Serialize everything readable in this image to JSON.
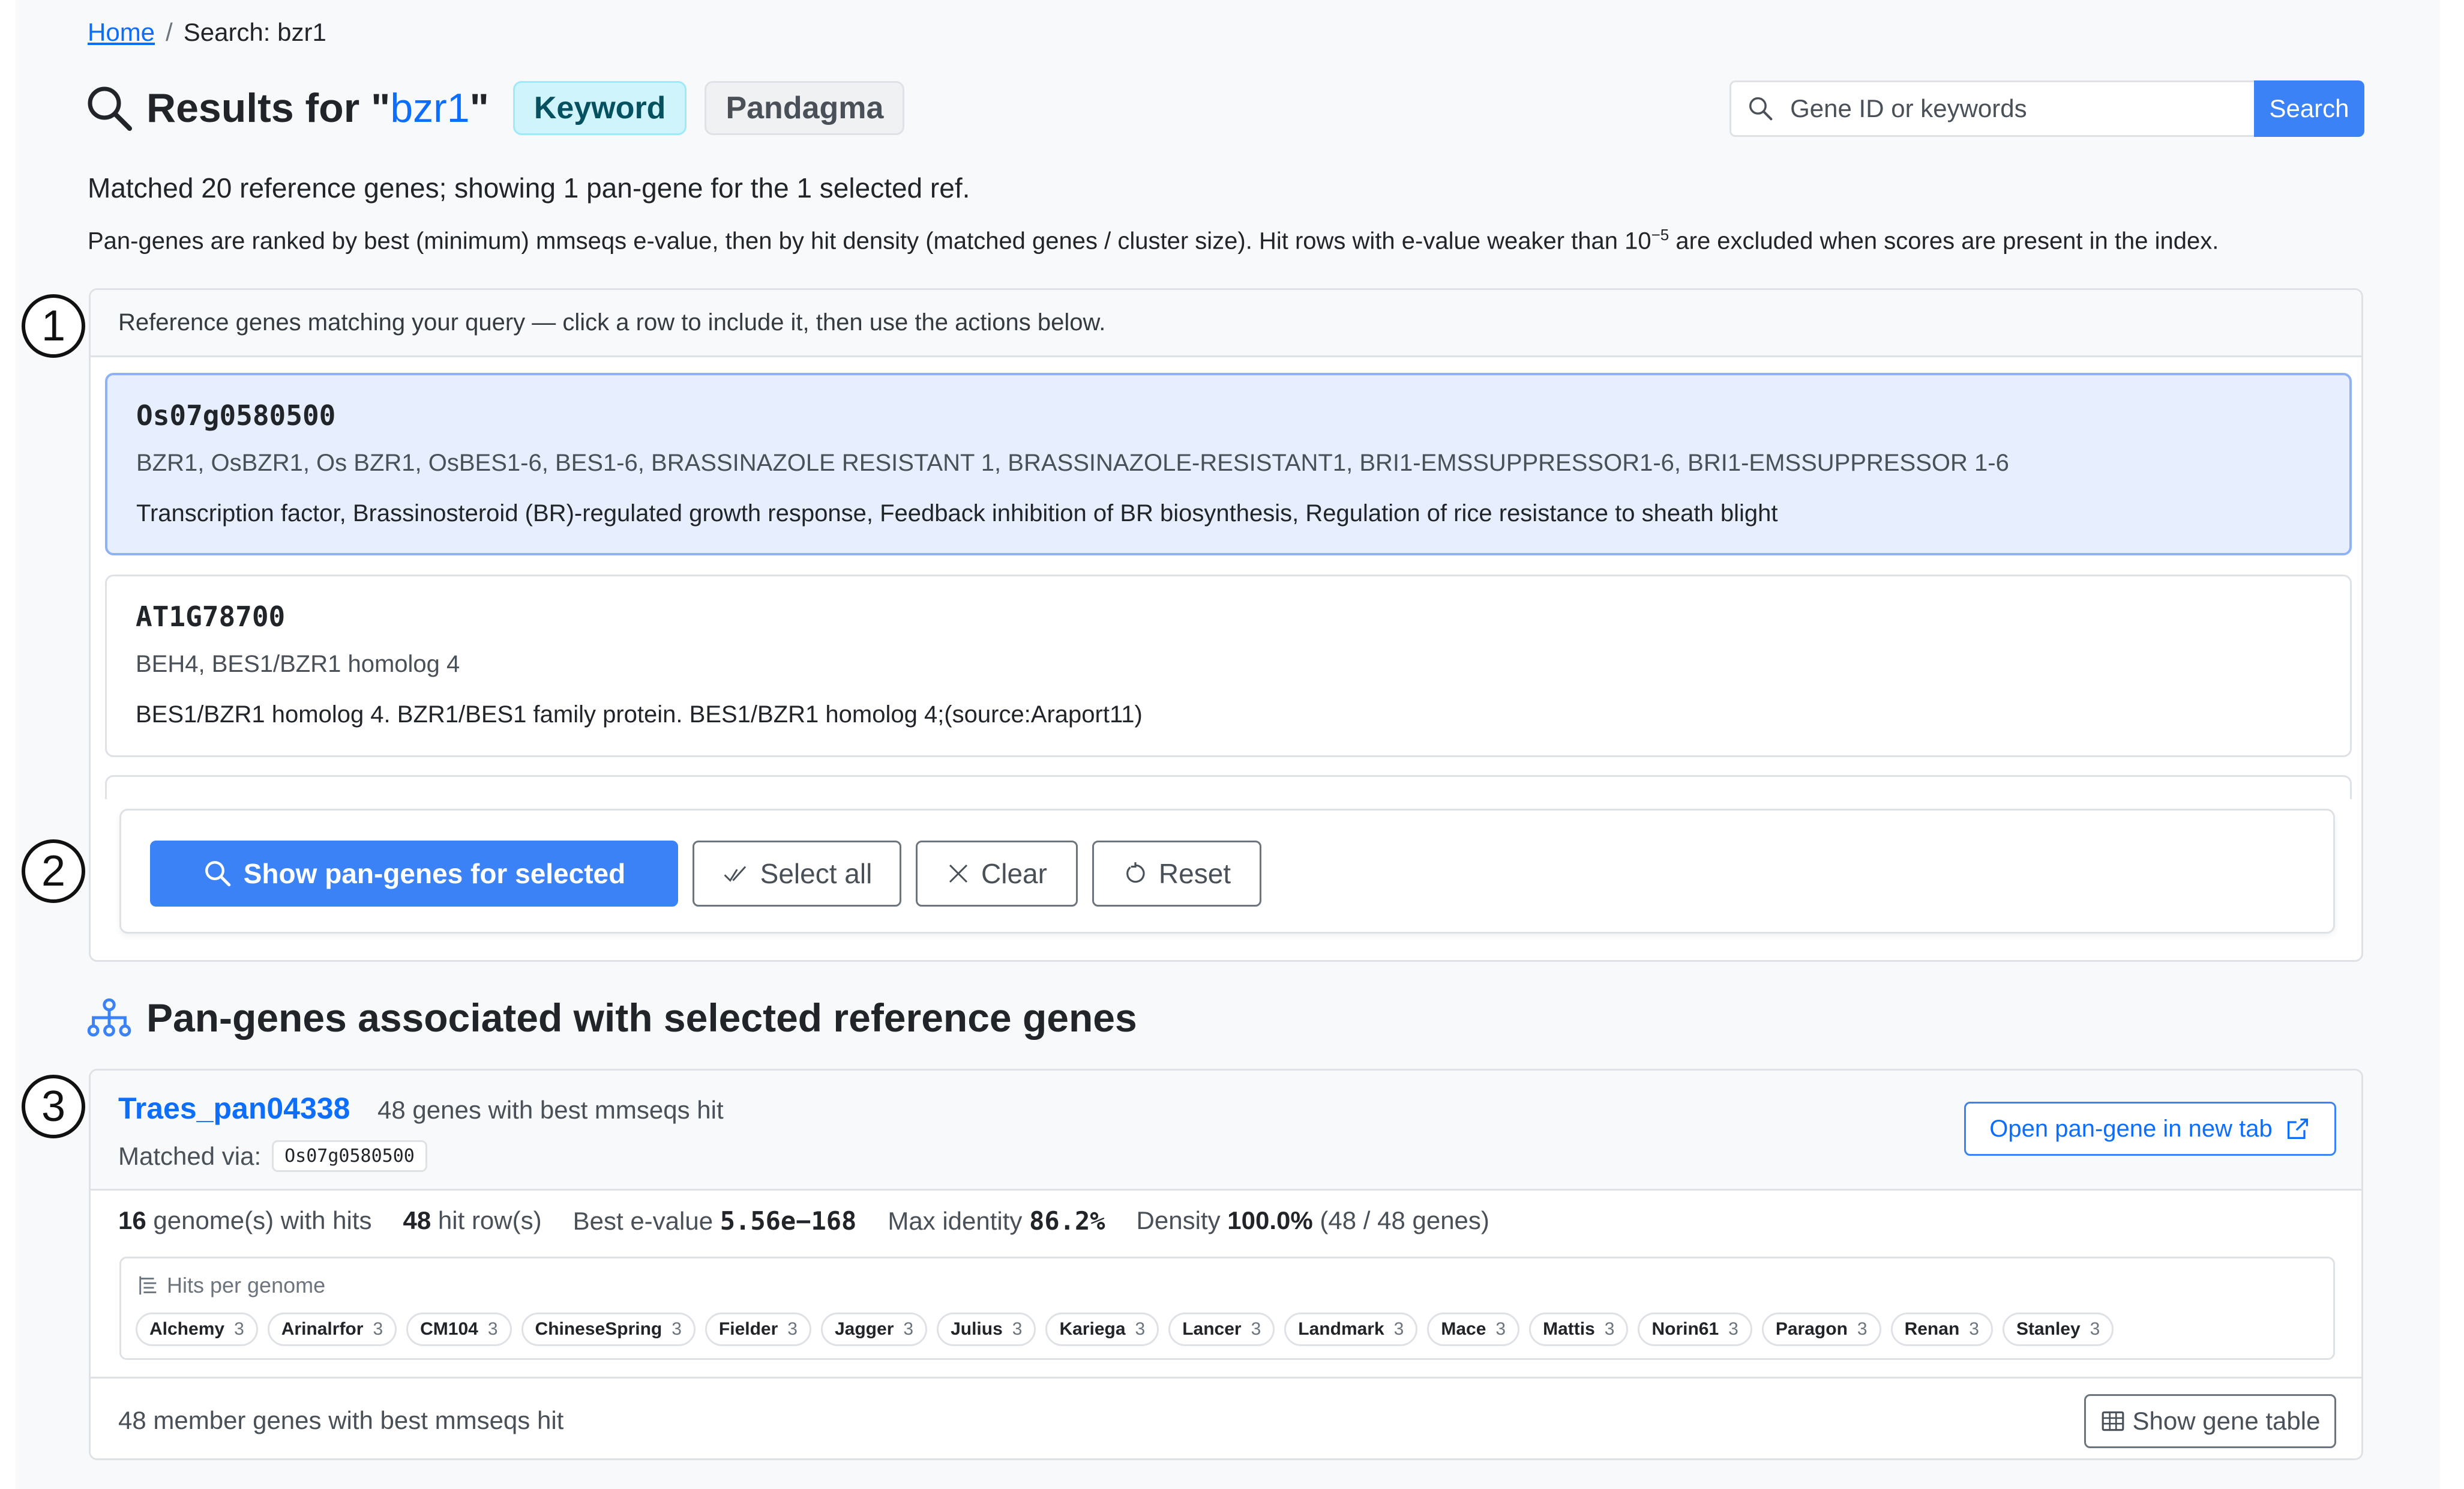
{
  "breadcrumb": {
    "home": "Home",
    "separator": "/",
    "current": "Search: bzr1"
  },
  "title": {
    "prefix": "Results for \"",
    "query": "bzr1",
    "suffix": "\""
  },
  "badges": {
    "keyword": "Keyword",
    "pandagma": "Pandagma"
  },
  "search": {
    "placeholder": "Gene ID or keywords",
    "button": "Search"
  },
  "summary": "Matched 20 reference genes; showing 1 pan-gene for the 1 selected ref.",
  "note": {
    "before": "Pan-genes are ranked by best (minimum) mmseqs e-value, then by hit density (matched genes / cluster size). Hit rows with e-value weaker than 10",
    "exponent": "−5",
    "after": " are excluded when scores are present in the index."
  },
  "callouts": [
    "1",
    "2",
    "3"
  ],
  "ref_panel": {
    "header": "Reference genes matching your query — click a row to include it, then use the actions below.",
    "genes": [
      {
        "id": "Os07g0580500",
        "synonyms": "BZR1, OsBZR1, Os BZR1, OsBES1-6, BES1-6, BRASSINAZOLE RESISTANT 1, BRASSINAZOLE-RESISTANT1, BRI1-EMSSUPPRESSOR1-6, BRI1-EMSSUPPRESSOR 1-6",
        "description": "Transcription factor, Brassinosteroid (BR)-regulated growth response, Feedback inhibition of BR biosynthesis, Regulation of rice resistance to sheath blight",
        "selected": true
      },
      {
        "id": "AT1G78700",
        "synonyms": "BEH4, BES1/BZR1 homolog 4",
        "description": "BES1/BZR1 homolog 4. BZR1/BES1 family protein. BES1/BZR1 homolog 4;(source:Araport11)",
        "selected": false
      }
    ],
    "actions": {
      "show": "Show pan-genes for selected",
      "select_all": "Select all",
      "clear": "Clear",
      "reset": "Reset"
    }
  },
  "section_heading": "Pan-genes associated with selected reference genes",
  "pan_gene": {
    "id": "Traes_pan04338",
    "subtitle": "48 genes with best mmseqs hit",
    "matched_via_label": "Matched via:",
    "matched_via": "Os07g0580500",
    "open_button": "Open pan-gene in new tab",
    "stats": {
      "genomes_count": "16",
      "genomes_label": "genome(s) with hits",
      "hit_rows_count": "48",
      "hit_rows_label": "hit row(s)",
      "evalue_label": "Best e-value",
      "evalue": "5.56e−168",
      "identity_label": "Max identity",
      "identity": "86.2%",
      "density_label": "Density",
      "density": "100.0%",
      "density_detail": "(48 / 48 genes)"
    },
    "hits_title": "Hits per genome",
    "genomes": [
      {
        "name": "Alchemy",
        "count": "3"
      },
      {
        "name": "Arinalrfor",
        "count": "3"
      },
      {
        "name": "CM104",
        "count": "3"
      },
      {
        "name": "ChineseSpring",
        "count": "3"
      },
      {
        "name": "Fielder",
        "count": "3"
      },
      {
        "name": "Jagger",
        "count": "3"
      },
      {
        "name": "Julius",
        "count": "3"
      },
      {
        "name": "Kariega",
        "count": "3"
      },
      {
        "name": "Lancer",
        "count": "3"
      },
      {
        "name": "Landmark",
        "count": "3"
      },
      {
        "name": "Mace",
        "count": "3"
      },
      {
        "name": "Mattis",
        "count": "3"
      },
      {
        "name": "Norin61",
        "count": "3"
      },
      {
        "name": "Paragon",
        "count": "3"
      },
      {
        "name": "Renan",
        "count": "3"
      },
      {
        "name": "Stanley",
        "count": "3"
      }
    ],
    "footer_text": "48 member genes with best mmseqs hit",
    "gene_table_button": "Show gene table"
  },
  "colors": {
    "accent": "#3b82f6",
    "link": "#0d6efd",
    "selected_bg": "#e7efff"
  }
}
